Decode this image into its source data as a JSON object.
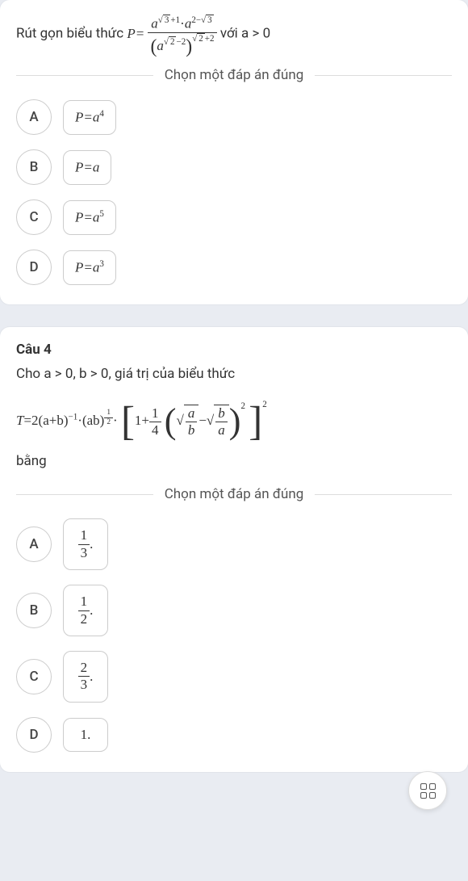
{
  "q3": {
    "lead_text": "Rút gọn biểu thức ",
    "var": "P",
    "num_base1": "a",
    "num_exp1_lhs": "3",
    "num_exp1_plus1": "+1",
    "dot": "·",
    "num_base2": "a",
    "num_exp2_lhs": "2−",
    "num_exp2_root": "3",
    "den_base": "a",
    "den_inner_exp_root": "2",
    "den_inner_exp_tail": "−2",
    "den_outer_exp_root": "2",
    "den_outer_exp_tail": "+2",
    "condition": " với a > 0",
    "prompt": "Chọn một đáp án đúng",
    "options": [
      {
        "letter": "A",
        "expr_lhs": "P=a",
        "expr_sup": "4"
      },
      {
        "letter": "B",
        "expr_lhs": "P=a",
        "expr_sup": ""
      },
      {
        "letter": "C",
        "expr_lhs": "P=a",
        "expr_sup": "5"
      },
      {
        "letter": "D",
        "expr_lhs": "P=a",
        "expr_sup": "3"
      }
    ]
  },
  "q4": {
    "label": "Câu 4",
    "lead_text": "Cho a > 0, b > 0, giá trị của biểu thức",
    "tail_text": "bằng",
    "T": "T",
    "eq": "=2(a+b)",
    "exp_neg1": "−1",
    "dot": "·",
    "ab": "(ab)",
    "half_num": "1",
    "half_den": "2",
    "one": "1",
    "plus": "+",
    "quarter_num": "1",
    "quarter_den": "4",
    "a": "a",
    "b": "b",
    "minus": "−",
    "pow2": "2",
    "prompt": "Chọn một đáp án đúng",
    "options": [
      {
        "letter": "A",
        "num": "1",
        "den": "3"
      },
      {
        "letter": "B",
        "num": "1",
        "den": "2"
      },
      {
        "letter": "C",
        "num": "2",
        "den": "3"
      },
      {
        "letter": "D",
        "plain": "1."
      }
    ]
  }
}
